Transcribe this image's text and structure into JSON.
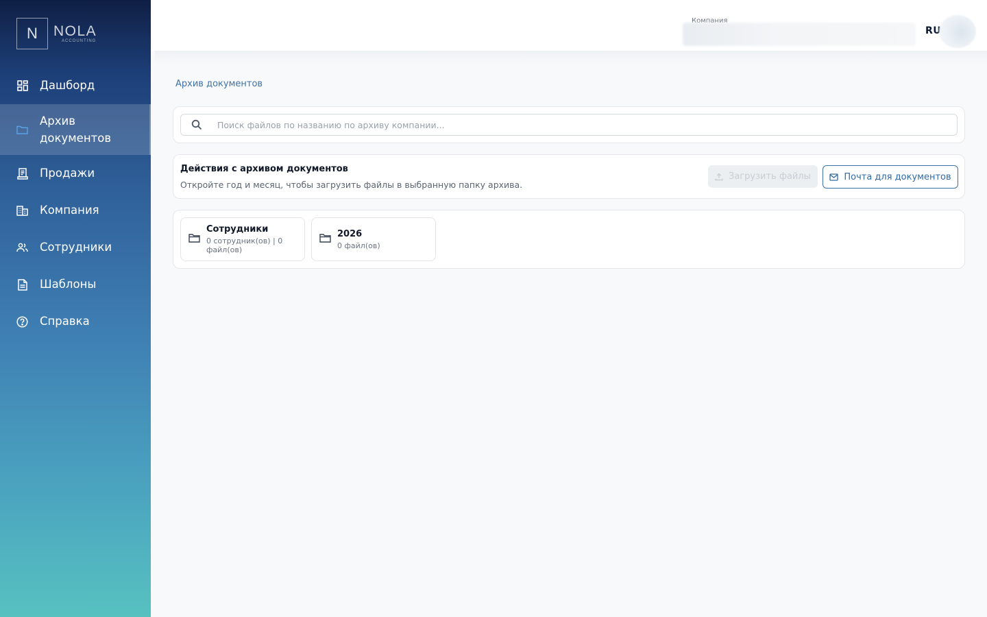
{
  "app": {
    "logo_letter": "N",
    "logo_word": "NOLA",
    "logo_sub": "ACCOUNTING"
  },
  "sidebar": {
    "items": [
      {
        "label": "Дашборд",
        "icon": "dashboard-icon",
        "active": false
      },
      {
        "label": "Архив документов",
        "icon": "folder-icon",
        "active": true
      },
      {
        "label": "Продажи",
        "icon": "receipt-icon",
        "active": false
      },
      {
        "label": "Компания",
        "icon": "building-icon",
        "active": false
      },
      {
        "label": "Сотрудники",
        "icon": "people-icon",
        "active": false
      },
      {
        "label": "Шаблоны",
        "icon": "document-icon",
        "active": false
      },
      {
        "label": "Справка",
        "icon": "help-icon",
        "active": false
      }
    ]
  },
  "header": {
    "company_label": "Компания",
    "language": "RU"
  },
  "breadcrumb": "Архив документов",
  "search": {
    "placeholder": "Поиск файлов по названию по архиву компании...",
    "value": ""
  },
  "actions": {
    "title": "Действия с архивом документов",
    "subtitle": "Откройте год и месяц, чтобы загрузить файлы в выбранную папку архива.",
    "upload_label": "Загрузить файлы",
    "mail_label": "Почта для документов"
  },
  "folders": [
    {
      "name": "Сотрудники",
      "meta": "0 сотрудник(ов) | 0 файл(ов)"
    },
    {
      "name": "2026",
      "meta": "0 файл(ов)"
    }
  ],
  "colors": {
    "accent": "#3d72a8",
    "sidebar_top": "#0f1f44",
    "sidebar_bottom": "#57c1c0"
  }
}
